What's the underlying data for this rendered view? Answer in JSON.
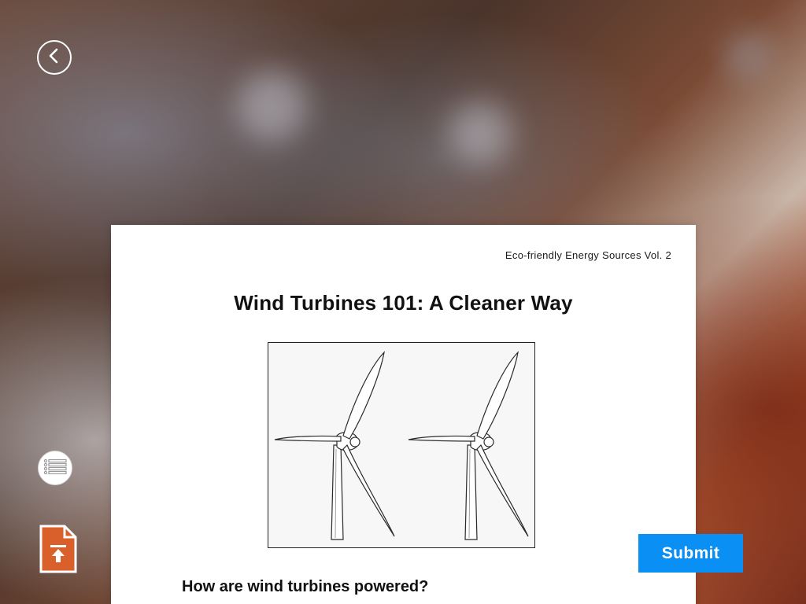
{
  "nav": {
    "back_icon": "chevron-left-icon",
    "toc_icon": "list-icon",
    "upload_icon": "document-upload-icon"
  },
  "card": {
    "series_label": "Eco-friendly Energy Sources Vol. 2",
    "title": "Wind Turbines 101: A Cleaner Way",
    "illustration": "two-wind-turbines-illustration",
    "question": "How are wind turbines powered?"
  },
  "actions": {
    "submit_label": "Submit",
    "submit_color": "#0a8ff5"
  }
}
